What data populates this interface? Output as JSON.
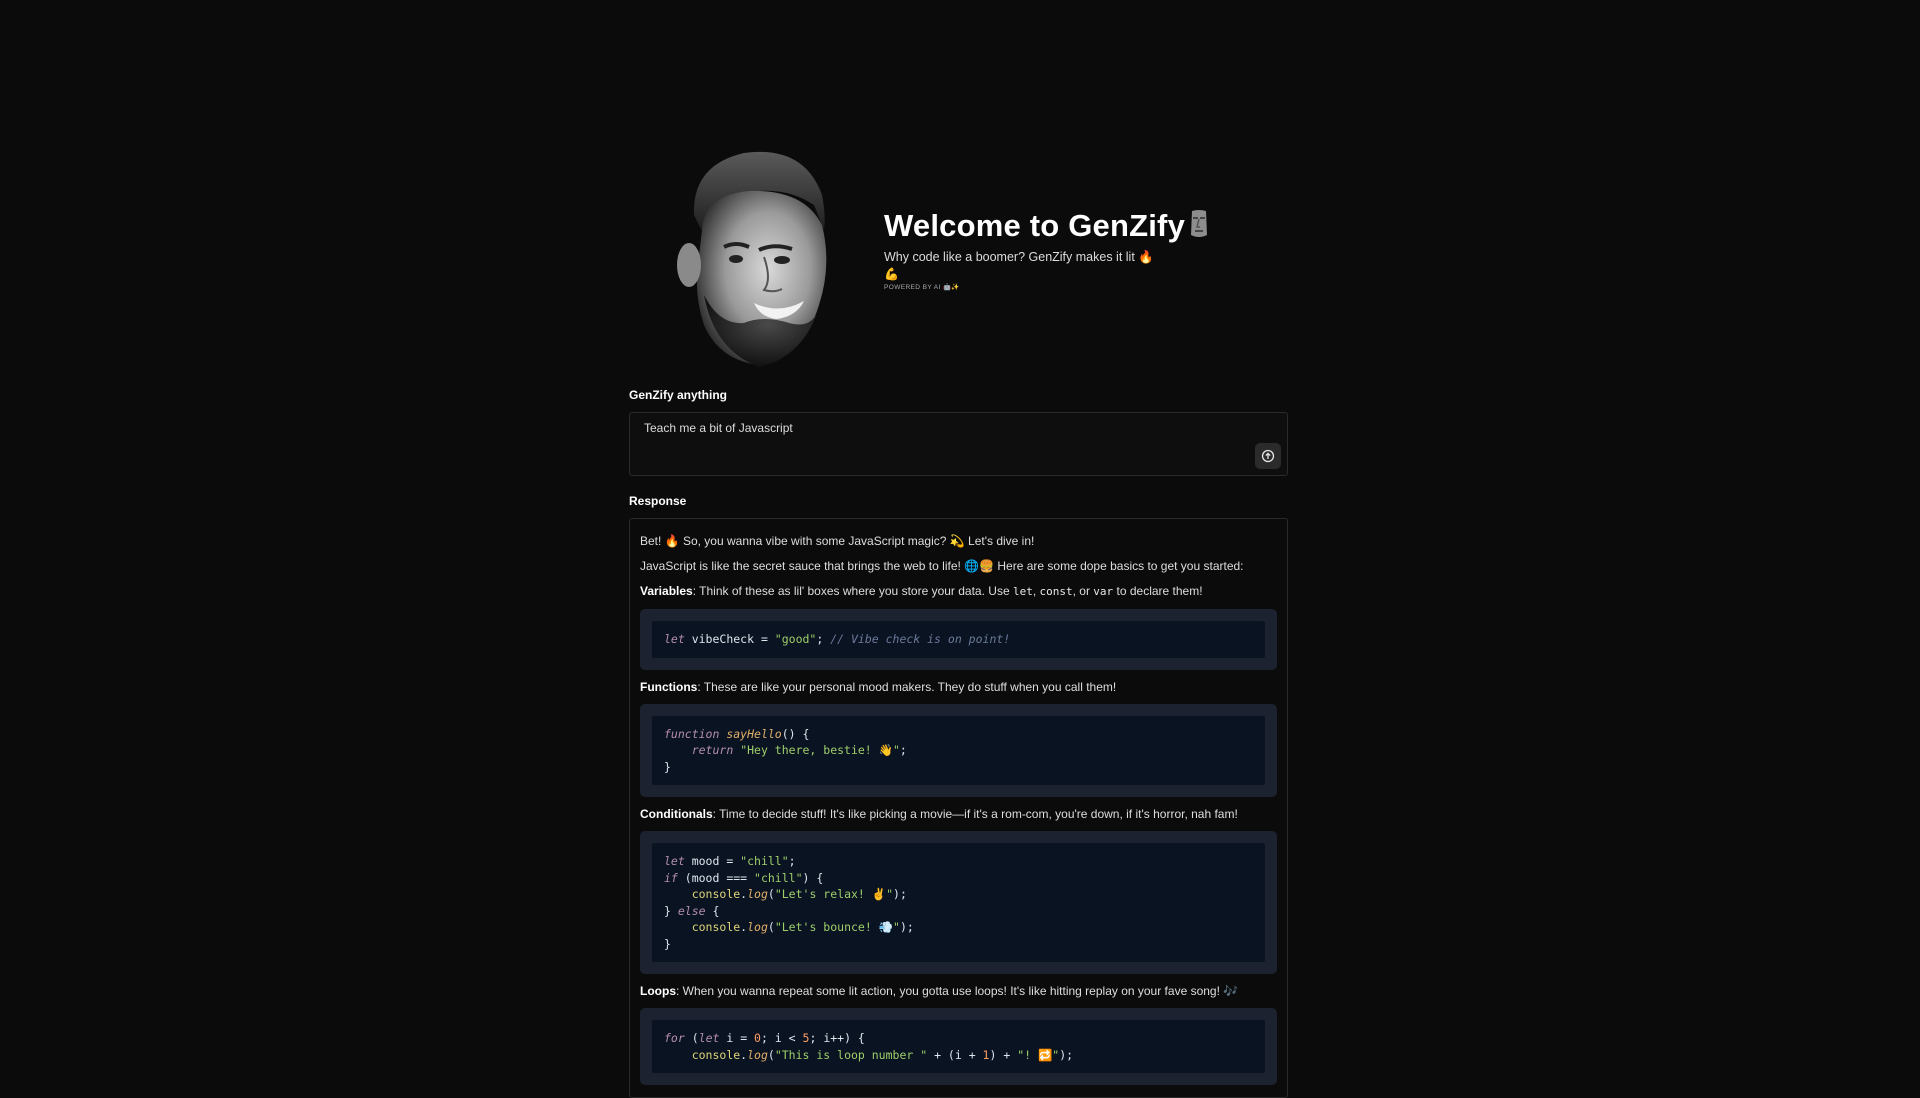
{
  "header": {
    "title": "Welcome to GenZify",
    "title_emoji": "moai-icon",
    "tagline": "Why code like a boomer? GenZify makes it lit 🔥",
    "tagline_line2": "💪",
    "powered_by": "POWERED BY AI 🤖✨"
  },
  "input": {
    "label": "GenZify anything",
    "value": "Teach me a bit of Javascript",
    "submit_icon": "arrow-up-circle-icon"
  },
  "response": {
    "label": "Response",
    "intro": "Bet! 🔥 So, you wanna vibe with some JavaScript magic? 💫 Let's dive in!",
    "intro2": "JavaScript is like the secret sauce that brings the web to life! 🌐🍔 Here are some dope basics to get you started:",
    "variables": {
      "heading": "Variables",
      "text_before": ": Think of these as lil' boxes where you store your data. Use ",
      "kw1": "let",
      "sep1": ", ",
      "kw2": "const",
      "sep2": ", or ",
      "kw3": "var",
      "text_after": " to declare them!",
      "code": {
        "kw": "let",
        "ident": " vibeCheck = ",
        "str": "\"good\"",
        "semi": "; ",
        "comment": "// Vibe check is on point!"
      }
    },
    "functions": {
      "heading": "Functions",
      "text": ": These are like your personal mood makers. They do stuff when you call them!",
      "code": {
        "kw_function": "function",
        "fn_name": "sayHello",
        "parens": "() {",
        "kw_return": "return",
        "str": "\"Hey there, bestie! 👋\"",
        "semi": ";",
        "close": "}"
      }
    },
    "conditionals": {
      "heading": "Conditionals",
      "text": ": Time to decide stuff! It's like picking a movie—if it's a rom-com, you're down, if it's horror, nah fam!",
      "code": {
        "kw_let": "let",
        "l1_ident": " mood = ",
        "l1_str": "\"chill\"",
        "l1_semi": ";",
        "kw_if": "if",
        "l2_a": " (mood === ",
        "l2_str": "\"chill\"",
        "l2_b": ") {",
        "l3_obj": "console",
        "l3_dot": ".",
        "l3_fn": "log",
        "l3_open": "(",
        "l3_str": "\"Let's relax! ✌️\"",
        "l3_close": ");",
        "l4_a": "} ",
        "kw_else": "else",
        "l4_b": " {",
        "l5_obj": "console",
        "l5_dot": ".",
        "l5_fn": "log",
        "l5_open": "(",
        "l5_str": "\"Let's bounce! 💨\"",
        "l5_close": ");",
        "close": "}"
      }
    },
    "loops": {
      "heading": "Loops",
      "text": ": When you wanna repeat some lit action, you gotta use loops! It's like hitting replay on your fave song! 🎶",
      "code": {
        "kw_for": "for",
        "l1_a": " (",
        "kw_let": "let",
        "l1_b": " i = ",
        "n0": "0",
        "l1_c": "; i < ",
        "n5": "5",
        "l1_d": "; i++) {",
        "l2_obj": "console",
        "l2_dot": ".",
        "l2_fn": "log",
        "l2_open": "(",
        "l2_str1": "\"This is loop number \"",
        "l2_mid": " + (i + ",
        "n1": "1",
        "l2_mid2": ") + ",
        "l2_str2": "\"! 🔁\"",
        "l2_close": ");"
      }
    }
  }
}
